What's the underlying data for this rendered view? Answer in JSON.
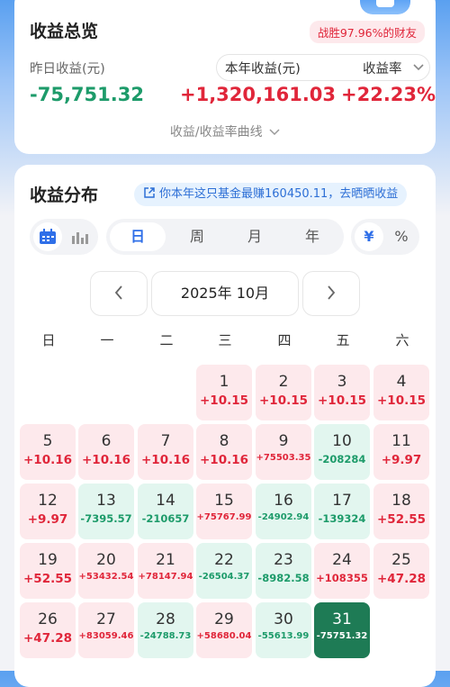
{
  "summary": {
    "title": "收益总览",
    "badge": "战胜97.96%的财友",
    "yesterday_label": "昨日收益(元)",
    "yesterday_value": "-75,751.32",
    "year_label": "本年收益(元)",
    "year_value": "+1,320,161.03",
    "rate_label": "收益率",
    "rate_value": "+22.23%",
    "curve_link": "收益/收益率曲线"
  },
  "distribution": {
    "title": "收益分布",
    "promo": "你本年这只基金最赚160450.11，去晒晒收益",
    "period_tabs": [
      "日",
      "周",
      "月",
      "年"
    ],
    "active_period": "日",
    "unit_tabs": [
      "¥",
      "%"
    ],
    "active_unit": "¥",
    "month_label": "2025年 10月",
    "weekdays": [
      "日",
      "一",
      "二",
      "三",
      "四",
      "五",
      "六"
    ],
    "selected_day": "31",
    "days": [
      {
        "d": "1",
        "v": "+10.15"
      },
      {
        "d": "2",
        "v": "+10.15"
      },
      {
        "d": "3",
        "v": "+10.15"
      },
      {
        "d": "4",
        "v": "+10.15"
      },
      {
        "d": "5",
        "v": "+10.16"
      },
      {
        "d": "6",
        "v": "+10.16"
      },
      {
        "d": "7",
        "v": "+10.16"
      },
      {
        "d": "8",
        "v": "+10.16"
      },
      {
        "d": "9",
        "v": "+75503.35"
      },
      {
        "d": "10",
        "v": "-208284"
      },
      {
        "d": "11",
        "v": "+9.97"
      },
      {
        "d": "12",
        "v": "+9.97"
      },
      {
        "d": "13",
        "v": "-7395.57"
      },
      {
        "d": "14",
        "v": "-210657"
      },
      {
        "d": "15",
        "v": "+75767.99"
      },
      {
        "d": "16",
        "v": "-24902.94"
      },
      {
        "d": "17",
        "v": "-139324"
      },
      {
        "d": "18",
        "v": "+52.55"
      },
      {
        "d": "19",
        "v": "+52.55"
      },
      {
        "d": "20",
        "v": "+53432.54"
      },
      {
        "d": "21",
        "v": "+78147.94"
      },
      {
        "d": "22",
        "v": "-26504.37"
      },
      {
        "d": "23",
        "v": "-8982.58"
      },
      {
        "d": "24",
        "v": "+108355"
      },
      {
        "d": "25",
        "v": "+47.28"
      },
      {
        "d": "26",
        "v": "+47.28"
      },
      {
        "d": "27",
        "v": "+83059.46"
      },
      {
        "d": "28",
        "v": "-24788.73"
      },
      {
        "d": "29",
        "v": "+58680.04"
      },
      {
        "d": "30",
        "v": "-55613.99"
      },
      {
        "d": "31",
        "v": "-75751.32"
      }
    ]
  },
  "colors": {
    "positive": "#e0263a",
    "negative": "#1d9b6a",
    "selected": "#1e7b55",
    "accent": "#2f6fe8"
  },
  "icons": [
    "calendar-icon",
    "bar-chart-icon",
    "chevron-down-icon",
    "chevron-left-icon",
    "chevron-right-icon",
    "share-icon"
  ]
}
